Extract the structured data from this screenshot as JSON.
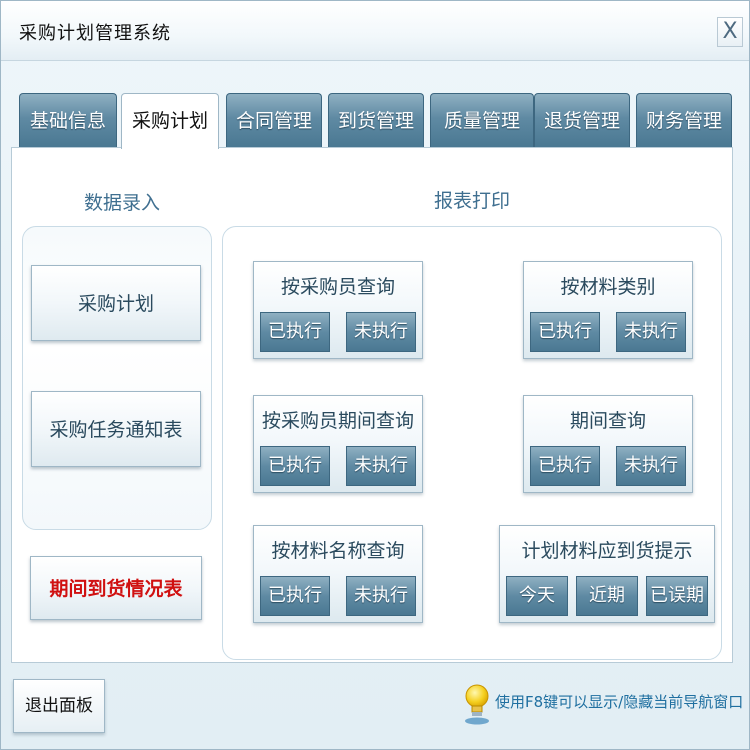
{
  "window": {
    "title": "采购计划管理系统",
    "close_label": "X"
  },
  "tabs": [
    {
      "label": "基础信息",
      "active": false
    },
    {
      "label": "采购计划",
      "active": true
    },
    {
      "label": "合同管理",
      "active": false
    },
    {
      "label": "到货管理",
      "active": false
    },
    {
      "label": "质量管理",
      "active": false
    },
    {
      "label": "退货管理",
      "active": false
    },
    {
      "label": "财务管理",
      "active": false
    }
  ],
  "data_entry": {
    "title": "数据录入",
    "buttons": [
      "采购计划",
      "采购任务通知表"
    ],
    "period_report": "期间到货情况表"
  },
  "report_print": {
    "title": "报表打印",
    "groups": [
      {
        "title": "按采购员查询",
        "buttons": [
          "已执行",
          "未执行"
        ]
      },
      {
        "title": "按材料类别",
        "buttons": [
          "已执行",
          "未执行"
        ]
      },
      {
        "title": "按采购员期间查询",
        "buttons": [
          "已执行",
          "未执行"
        ]
      },
      {
        "title": "期间查询",
        "buttons": [
          "已执行",
          "未执行"
        ]
      },
      {
        "title": "按材料名称查询",
        "buttons": [
          "已执行",
          "未执行"
        ]
      },
      {
        "title": "计划材料应到货提示",
        "buttons": [
          "今天",
          "近期",
          "已误期"
        ]
      }
    ]
  },
  "footer": {
    "exit_label": "退出面板",
    "hint": "使用F8键可以显示/隐藏当前导航窗口"
  },
  "colors": {
    "accent": "#4a7892",
    "alert": "#d01010",
    "hint": "#1f6fa0"
  }
}
